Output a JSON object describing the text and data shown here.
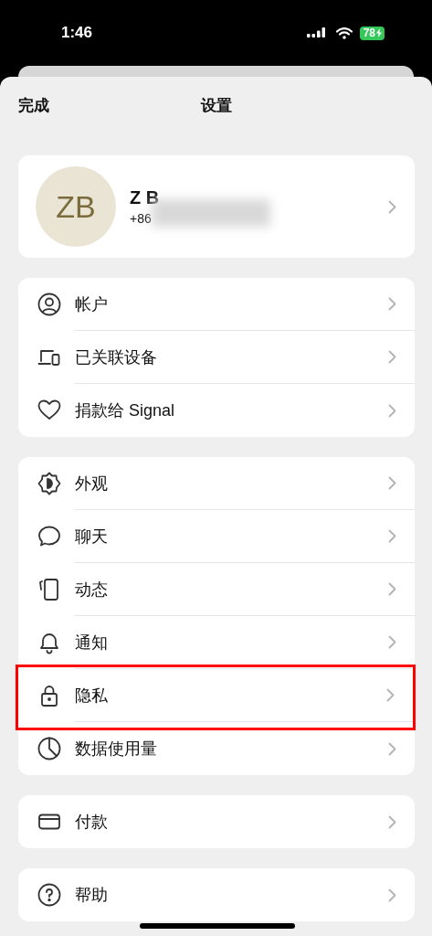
{
  "status_bar": {
    "time": "1:46",
    "battery": "78"
  },
  "header": {
    "done": "完成",
    "title": "设置"
  },
  "profile": {
    "initials": "ZB",
    "name": "Z B",
    "phone": "+86"
  },
  "groups": [
    {
      "items": [
        {
          "label": "帐户",
          "highlighted": false
        },
        {
          "label": "已关联设备",
          "highlighted": false
        },
        {
          "label": "捐款给 Signal",
          "highlighted": false
        }
      ]
    },
    {
      "items": [
        {
          "label": "外观",
          "highlighted": false
        },
        {
          "label": "聊天",
          "highlighted": false
        },
        {
          "label": "动态",
          "highlighted": false
        },
        {
          "label": "通知",
          "highlighted": false
        },
        {
          "label": "隐私",
          "highlighted": true
        },
        {
          "label": "数据使用量",
          "highlighted": false
        }
      ]
    },
    {
      "items": [
        {
          "label": "付款",
          "highlighted": false
        }
      ]
    },
    {
      "items": [
        {
          "label": "帮助",
          "highlighted": false
        }
      ]
    }
  ]
}
